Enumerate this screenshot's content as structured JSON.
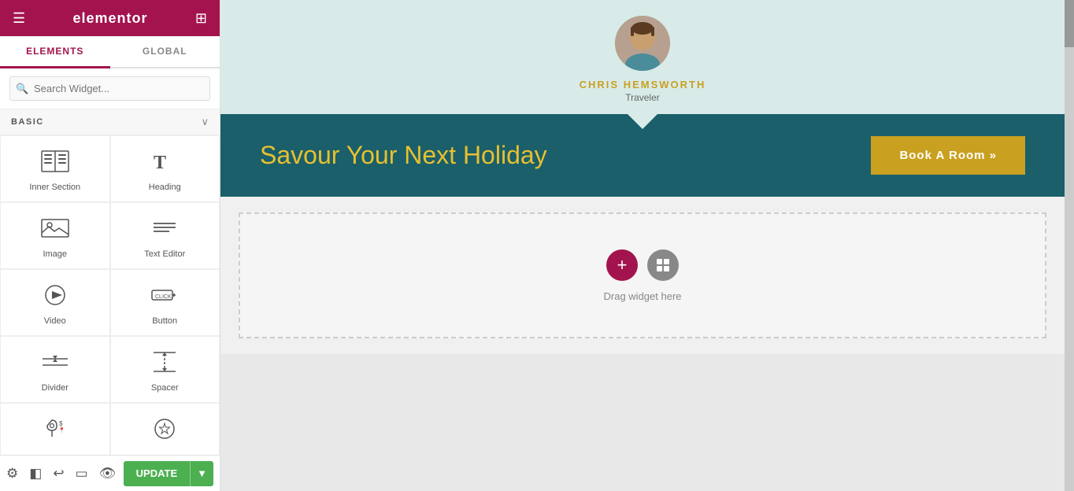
{
  "header": {
    "title": "elementor",
    "menu_icon": "☰",
    "grid_icon": "⊞"
  },
  "tabs": {
    "elements": "ELEMENTS",
    "global": "GLOBAL"
  },
  "search": {
    "placeholder": "Search Widget..."
  },
  "section": {
    "basic_label": "BASIC"
  },
  "widgets": [
    {
      "id": "inner-section",
      "label": "Inner Section",
      "icon": "inner_section"
    },
    {
      "id": "heading",
      "label": "Heading",
      "icon": "heading"
    },
    {
      "id": "image",
      "label": "Image",
      "icon": "image"
    },
    {
      "id": "text-editor",
      "label": "Text Editor",
      "icon": "text_editor"
    },
    {
      "id": "video",
      "label": "Video",
      "icon": "video"
    },
    {
      "id": "button",
      "label": "Button",
      "icon": "button"
    },
    {
      "id": "divider",
      "label": "Divider",
      "icon": "divider"
    },
    {
      "id": "spacer",
      "label": "Spacer",
      "icon": "spacer"
    },
    {
      "id": "icon1",
      "label": "",
      "icon": "map_pin"
    },
    {
      "id": "icon2",
      "label": "",
      "icon": "star_circle"
    }
  ],
  "bottom_toolbar": {
    "update_label": "UPDATE"
  },
  "canvas": {
    "profile": {
      "name": "CHRIS HEMSWORTH",
      "role": "Traveler"
    },
    "banner": {
      "text_main": "Savour Your Next ",
      "text_highlight": "Holiday",
      "button_label": "Book A Room »"
    },
    "drag_area": {
      "label": "Drag widget here"
    }
  }
}
